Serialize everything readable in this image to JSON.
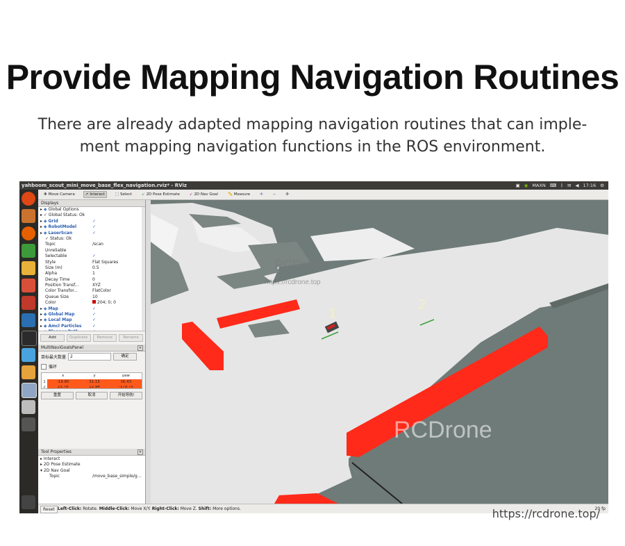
{
  "headline": "Provide Mapping Navigation Routines",
  "subtitle_line1": "There are already adapted mapping navigation routines that can imple-",
  "subtitle_line2": "ment mapping navigation functions in the ROS environment.",
  "window": {
    "title": "yahboom_scout_mini_move_base_flex_navigation.rviz* - RViz",
    "tray": [
      "MAXN",
      "17:16"
    ]
  },
  "toolbar": {
    "move_camera": "Move Camera",
    "interact": "Interact",
    "select": "Select",
    "pose_estimate": "2D Pose Estimate",
    "nav_goal": "2D Nav Goal",
    "measure": "Measure"
  },
  "displays": {
    "title": "Displays",
    "rows": [
      {
        "name": "Global Options",
        "value": "",
        "indent": 1,
        "blue": false,
        "icon": "gear-icon"
      },
      {
        "name": "Global Status: Ok",
        "value": "",
        "indent": 1,
        "blue": false,
        "icon": "check-icon"
      },
      {
        "name": "Grid",
        "value": "✓",
        "indent": 1,
        "blue": true,
        "icon": "grid-icon"
      },
      {
        "name": "RobotModel",
        "value": "✓",
        "indent": 1,
        "blue": true,
        "icon": "robot-icon"
      },
      {
        "name": "LaserScan",
        "value": "✓",
        "indent": 1,
        "blue": true,
        "icon": "laser-icon"
      },
      {
        "name": "Status: Ok",
        "value": "",
        "indent": 2,
        "blue": false,
        "icon": "check-icon"
      },
      {
        "name": "Topic",
        "value": "/scan",
        "indent": 2,
        "blue": false,
        "icon": ""
      },
      {
        "name": "Unreliable",
        "value": "",
        "indent": 2,
        "blue": false,
        "icon": ""
      },
      {
        "name": "Selectable",
        "value": "✓",
        "indent": 2,
        "blue": false,
        "icon": ""
      },
      {
        "name": "Style",
        "value": "Flat Squares",
        "indent": 2,
        "blue": false,
        "icon": ""
      },
      {
        "name": "Size (m)",
        "value": "0.5",
        "indent": 2,
        "blue": false,
        "icon": ""
      },
      {
        "name": "Alpha",
        "value": "1",
        "indent": 2,
        "blue": false,
        "icon": ""
      },
      {
        "name": "Decay Time",
        "value": "0",
        "indent": 2,
        "blue": false,
        "icon": ""
      },
      {
        "name": "Position Transf...",
        "value": "XYZ",
        "indent": 2,
        "blue": false,
        "icon": ""
      },
      {
        "name": "Color Transfor...",
        "value": "FlatColor",
        "indent": 2,
        "blue": false,
        "icon": ""
      },
      {
        "name": "Queue Size",
        "value": "10",
        "indent": 2,
        "blue": false,
        "icon": ""
      },
      {
        "name": "Color",
        "value": "204; 0; 0",
        "indent": 2,
        "blue": false,
        "icon": "",
        "swatch": "#cc0000"
      },
      {
        "name": "Map",
        "value": "✓",
        "indent": 1,
        "blue": true,
        "icon": "map-icon"
      },
      {
        "name": "Global Map",
        "value": "✓",
        "indent": 1,
        "blue": true,
        "icon": "folder-icon"
      },
      {
        "name": "Local Map",
        "value": "✓",
        "indent": 1,
        "blue": true,
        "icon": "folder-icon"
      },
      {
        "name": "Amcl Particles",
        "value": "✓",
        "indent": 1,
        "blue": true,
        "icon": "particles-icon"
      },
      {
        "name": "Planner Path",
        "value": "✓",
        "indent": 1,
        "blue": true,
        "icon": "path-icon"
      },
      {
        "name": "Target Pose",
        "value": "✓",
        "indent": 1,
        "blue": true,
        "icon": "pose-icon"
      }
    ],
    "buttons": [
      "Add",
      "Duplicate",
      "Remove",
      "Rename"
    ]
  },
  "multi_navi": {
    "title": "MultiNaviGoalsPanel",
    "max_label": "目标最大数量",
    "max_value": "2",
    "confirm": "确定",
    "loop_label": "循环",
    "columns": [
      "x",
      "y",
      "yaw"
    ],
    "rows": [
      {
        "idx": "1",
        "x": "-19.80",
        "y": "31.15",
        "yaw": "16.43"
      },
      {
        "idx": "2",
        "x": "23.78",
        "y": "12.94",
        "yaw": "-179.75"
      }
    ],
    "actions": [
      "重置",
      "取消",
      "开始导航!"
    ]
  },
  "tool_props": {
    "title": "Tool Properties",
    "rows": [
      {
        "name": "Interact",
        "value": ""
      },
      {
        "name": "2D Pose Estimate",
        "value": ""
      },
      {
        "name": "2D Nav Goal",
        "value": ""
      },
      {
        "name": "Topic",
        "value": "/move_base_simple/g..."
      }
    ]
  },
  "status": {
    "reset": "Reset",
    "hint_bold1": "Left-Click:",
    "hint1": " Rotate. ",
    "hint_bold2": "Middle-Click:",
    "hint2": " Move X/Y. ",
    "hint_bold3": "Right-Click:",
    "hint3": " Move Z. ",
    "hint_bold4": "Shift:",
    "hint4": " More options.",
    "fps": "20 fp"
  },
  "viewport": {
    "goal_1": "1",
    "goal_2": "2",
    "watermark": "RCDrone",
    "watermark_small": "RCDrone",
    "watermark_url": "https://rcdrone.top"
  },
  "footer_url": "https://rcdrone.top/",
  "colors": {
    "laser": "#ff2a1a",
    "map_free": "#e9e9e9",
    "map_unknown": "#6f7b78"
  }
}
